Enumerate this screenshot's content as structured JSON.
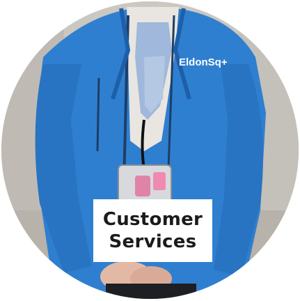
{
  "photo": {
    "subject": "staff-member-blue-jacket",
    "jacket_logo": "EldonSq",
    "colors": {
      "jacket": "#2f7fd0",
      "jacket_shadow": "#1d5fa8",
      "blouse": "#e9e6e1",
      "scarf": "#9fb8db",
      "background": "#c8c4be"
    }
  },
  "label": {
    "line1": "Customer",
    "line2": "Services"
  }
}
